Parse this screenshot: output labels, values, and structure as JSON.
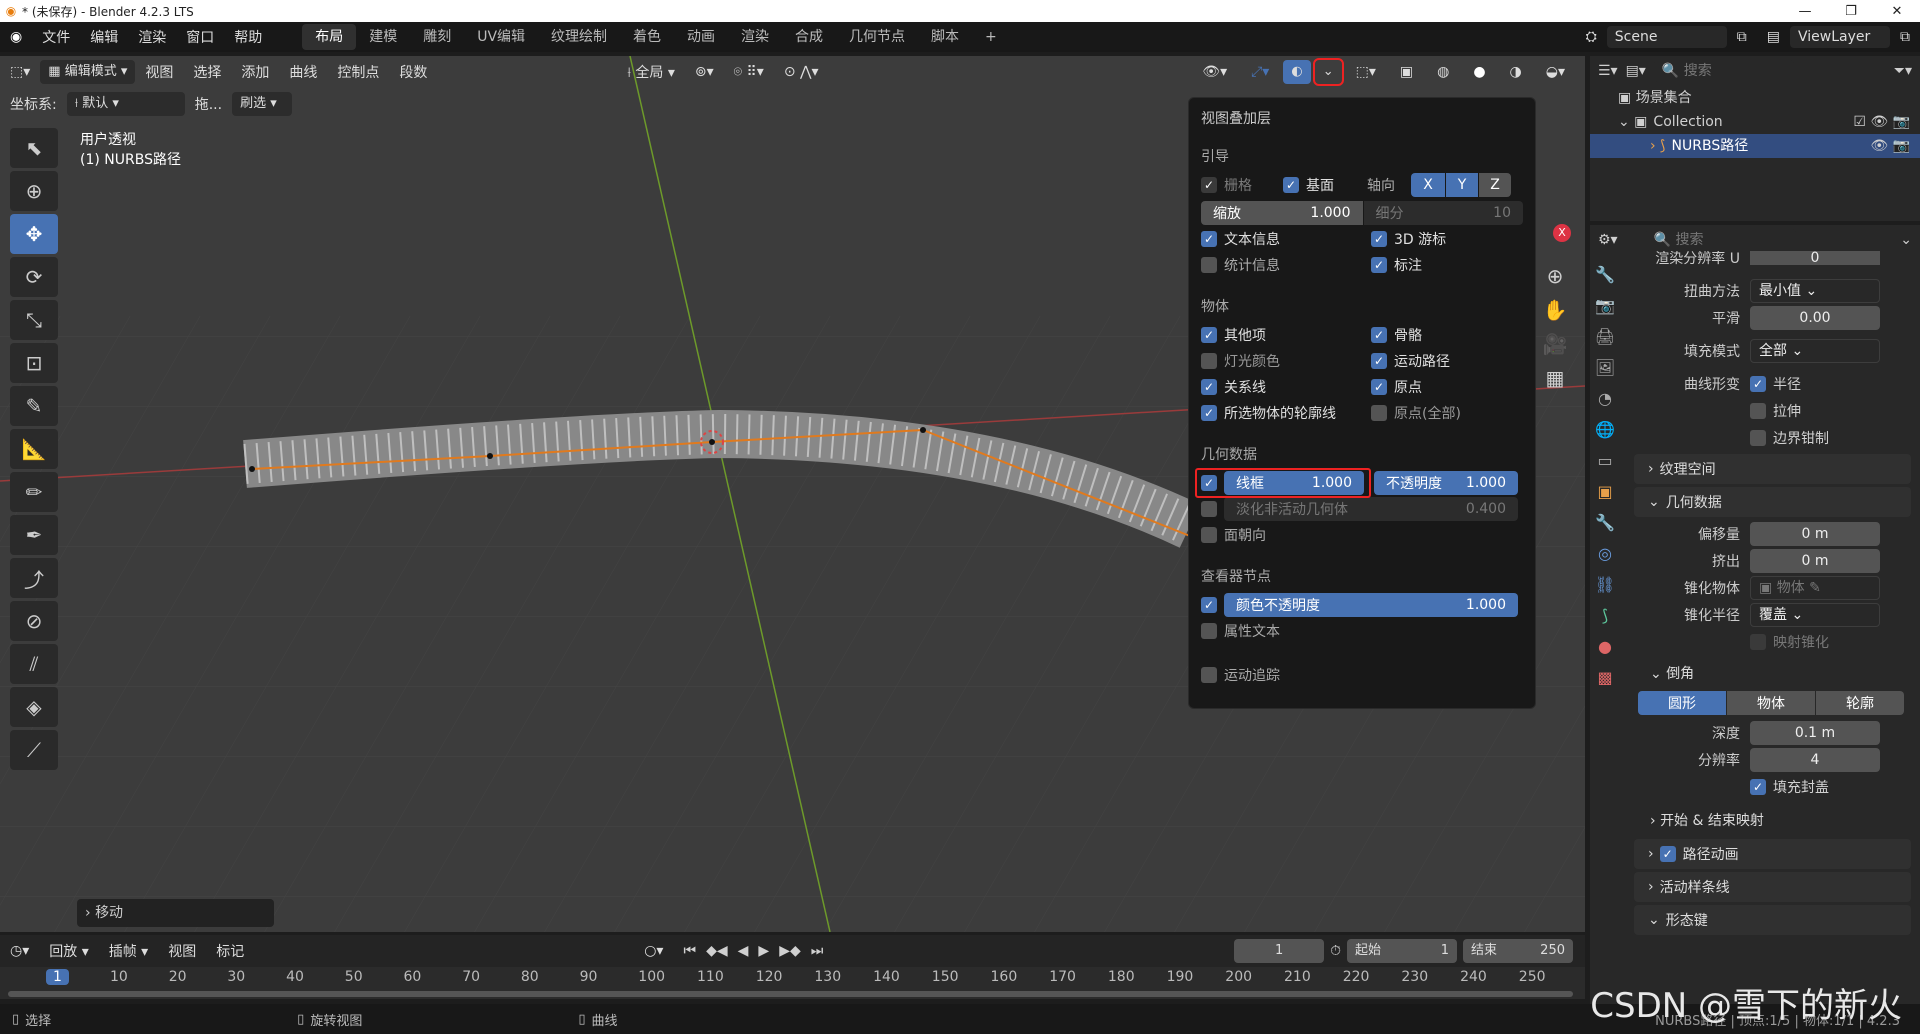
{
  "window": {
    "title": "* (未保存) - Blender 4.2.3 LTS",
    "minimize": "—",
    "maximize": "❐",
    "close": "✕"
  },
  "menu": {
    "items": [
      "文件",
      "编辑",
      "渲染",
      "窗口",
      "帮助"
    ],
    "workspaces": [
      "布局",
      "建模",
      "雕刻",
      "UV编辑",
      "纹理绘制",
      "着色",
      "动画",
      "渲染",
      "合成",
      "几何节点",
      "脚本"
    ],
    "active_workspace": "布局",
    "add_workspace": "+",
    "scene": "Scene",
    "view_layer": "ViewLayer"
  },
  "viewport_header": {
    "mode": "编辑模式",
    "menus": [
      "视图",
      "选择",
      "添加",
      "曲线",
      "控制点",
      "段数"
    ],
    "transform_orientation": "全局",
    "coord_label": "坐标系:",
    "coord_value": "默认",
    "drag_label": "拖...",
    "drag_value": "刷选"
  },
  "viewport": {
    "view_name": "用户透视",
    "object_name": "(1) NURBS路径",
    "last_op": "移动"
  },
  "overlay": {
    "title": "视图叠加层",
    "guides": {
      "header": "引导",
      "grid": "栅格",
      "floor": "基面",
      "axes": "轴向",
      "axis_x": "X",
      "axis_y": "Y",
      "axis_z": "Z",
      "scale_label": "缩放",
      "scale_value": "1.000",
      "subdiv_label": "细分",
      "subdiv_value": "10",
      "text_info": "文本信息",
      "cursor_3d": "3D 游标",
      "stats": "统计信息",
      "annotations": "标注"
    },
    "objects": {
      "header": "物体",
      "extras": "其他项",
      "bones": "骨骼",
      "light_colors": "灯光颜色",
      "motion_paths": "运动路径",
      "relations": "关系线",
      "origins": "原点",
      "outline_selected": "所选物体的轮廓线",
      "origins_all": "原点(全部)"
    },
    "geometry": {
      "header": "几何数据",
      "wireframe_label": "线框",
      "wireframe_value": "1.000",
      "opacity_label": "不透明度",
      "opacity_value": "1.000",
      "fade_inactive": "淡化非活动几何体",
      "fade_value": "0.400",
      "face_orientation": "面朝向"
    },
    "viewer_node": {
      "header": "查看器节点",
      "color_opacity_label": "颜色不透明度",
      "color_opacity_value": "1.000",
      "attribute_text": "属性文本"
    },
    "motion_tracking": "运动追踪"
  },
  "outliner": {
    "search_placeholder": "搜索",
    "scene_collection": "场景集合",
    "collection": "Collection",
    "object": "NURBS路径"
  },
  "properties": {
    "search_placeholder": "搜索",
    "render_resolution": "渲染分辨率 U",
    "render_resolution_value": "0",
    "twist_method_label": "扭曲方法",
    "twist_method_value": "最小值",
    "smooth_label": "平滑",
    "smooth_value": "0.00",
    "fill_mode_label": "填充模式",
    "fill_mode_value": "全部",
    "curve_deform_label": "曲线形变",
    "radius": "半径",
    "stretch": "拉伸",
    "bounds_clamp": "边界钳制",
    "texture_space": "纹理空间",
    "geometry": "几何数据",
    "offset_label": "偏移量",
    "offset_value": "0 m",
    "extrude_label": "挤出",
    "extrude_value": "0 m",
    "taper_object_label": "锥化物体",
    "taper_object_placeholder": "物体",
    "taper_radius_label": "锥化半径",
    "taper_radius_value": "覆盖",
    "map_taper": "映射锥化",
    "bevel": "倒角",
    "bevel_modes": [
      "圆形",
      "物体",
      "轮廓"
    ],
    "depth_label": "深度",
    "depth_value": "0.1 m",
    "resolution_label": "分辨率",
    "resolution_value": "4",
    "fill_caps": "填充封盖",
    "start_end_mapping": "开始 & 结束映射",
    "path_animation": "路径动画",
    "active_spline": "活动样条线",
    "shape_keys": "形态键"
  },
  "timeline": {
    "playback": "回放",
    "keying": "插帧",
    "view": "视图",
    "marker": "标记",
    "current_frame": "1",
    "start_label": "起始",
    "start_value": "1",
    "end_label": "结束",
    "end_value": "250",
    "ticks": [
      "1",
      "10",
      "20",
      "30",
      "40",
      "50",
      "60",
      "70",
      "80",
      "90",
      "100",
      "110",
      "120",
      "130",
      "140",
      "150",
      "160",
      "170",
      "180",
      "190",
      "200",
      "210",
      "220",
      "230",
      "240",
      "250"
    ]
  },
  "statusbar": {
    "select": "选择",
    "rotate_view": "旋转视图",
    "curve": "曲线",
    "info": "NURBS路径 | 顶点:1/5 | 物体:1/1 | 4.2.3"
  },
  "watermark": "CSDN @雪下的新火",
  "colors": {
    "accent": "#4772b3",
    "highlight_box": "#ee2222",
    "viewport_bg": "#3c3c3c",
    "panel_bg": "#282828"
  }
}
